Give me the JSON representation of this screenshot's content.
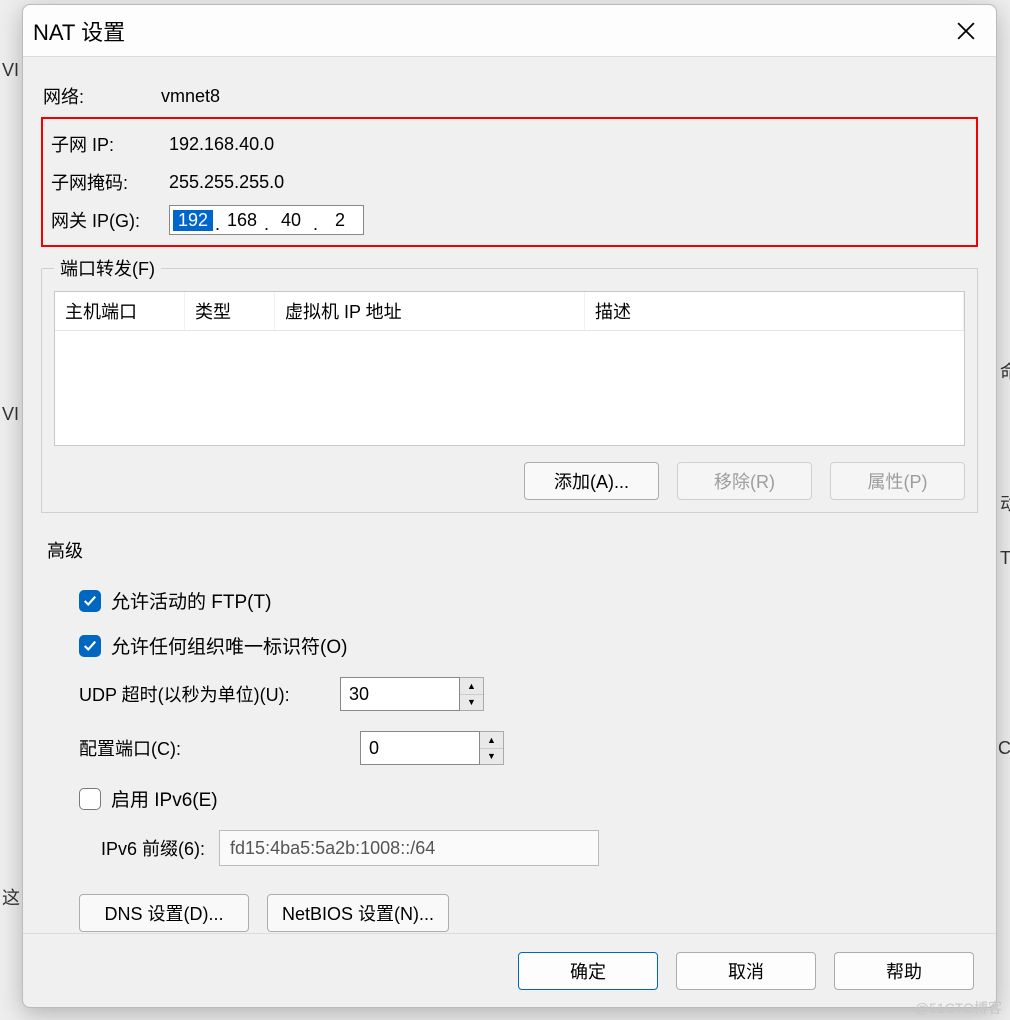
{
  "dialog": {
    "title": "NAT 设置",
    "network_label": "网络:",
    "network_value": "vmnet8",
    "subnet_ip_label": "子网 IP:",
    "subnet_ip_value": "192.168.40.0",
    "subnet_mask_label": "子网掩码:",
    "subnet_mask_value": "255.255.255.0",
    "gateway_label": "网关 IP(G):",
    "gateway_octets": [
      "192",
      "168",
      "40",
      "2"
    ]
  },
  "port_forward": {
    "legend": "端口转发(F)",
    "cols": {
      "host_port": "主机端口",
      "type": "类型",
      "vm_ip": "虚拟机 IP 地址",
      "desc": "描述"
    },
    "buttons": {
      "add": "添加(A)...",
      "remove": "移除(R)",
      "props": "属性(P)"
    }
  },
  "advanced": {
    "title": "高级",
    "ftp_active": "允许活动的 FTP(T)",
    "allow_org_id": "允许任何组织唯一标识符(O)",
    "udp_label": "UDP 超时(以秒为单位)(U):",
    "udp_value": "30",
    "config_port_label": "配置端口(C):",
    "config_port_value": "0",
    "enable_ipv6": "启用 IPv6(E)",
    "ipv6_prefix_label": "IPv6 前缀(6):",
    "ipv6_prefix_value": "fd15:4ba5:5a2b:1008::/64",
    "dns_btn": "DNS 设置(D)...",
    "netbios_btn": "NetBIOS 设置(N)..."
  },
  "footer": {
    "ok": "确定",
    "cancel": "取消",
    "help": "帮助"
  },
  "bg": {
    "v1": "VI",
    "v2": "VI",
    "topical": "这",
    "side_cmd": "命",
    "side_dong": "动",
    "side_t": "T",
    "side_c": "CI"
  },
  "watermark": "@51CTO博客"
}
